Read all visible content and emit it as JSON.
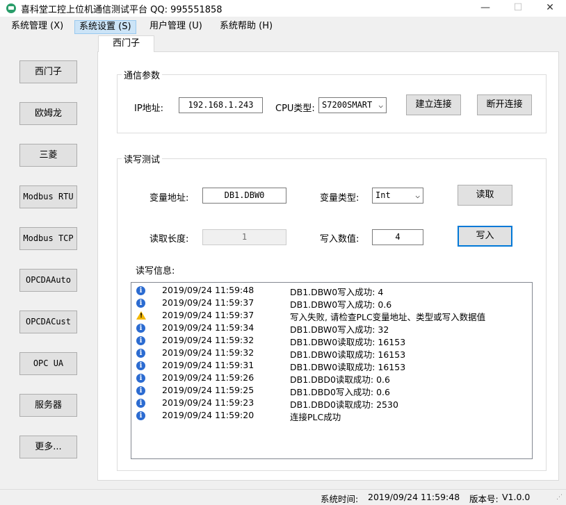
{
  "window": {
    "title": "喜科堂工控上位机通信测试平台 QQ: 995551858",
    "minimize": "—",
    "maximize": "☐",
    "close": "✕"
  },
  "menu": [
    "系统管理 (X)",
    "系统设置 (S)",
    "用户管理 (U)",
    "系统帮助 (H)"
  ],
  "sidebar": [
    "西门子",
    "欧姆龙",
    "三菱",
    "Modbus RTU",
    "Modbus TCP",
    "OPCDAAuto",
    "OPCDACust",
    "OPC UA",
    "服务器",
    "更多..."
  ],
  "tab": {
    "label": "西门子"
  },
  "comm": {
    "title": "通信参数",
    "ip_label": "IP地址:",
    "ip_value": "192.168.1.243",
    "cpu_label": "CPU类型:",
    "cpu_value": "S7200SMART",
    "connect_btn": "建立连接",
    "disconnect_btn": "断开连接"
  },
  "rw": {
    "title": "读写测试",
    "addr_label": "变量地址:",
    "addr_value": "DB1.DBW0",
    "type_label": "变量类型:",
    "type_value": "Int",
    "read_btn": "读取",
    "len_label": "读取长度:",
    "len_value": "1",
    "write_label": "写入数值:",
    "write_value": "4",
    "write_btn": "写入",
    "info_label": "读写信息:"
  },
  "log": [
    {
      "level": "info",
      "time": "2019/09/24 11:59:48",
      "msg": "DB1.DBW0写入成功: 4"
    },
    {
      "level": "info",
      "time": "2019/09/24 11:59:37",
      "msg": "DB1.DBW0写入成功: 0.6"
    },
    {
      "level": "warning",
      "time": "2019/09/24 11:59:37",
      "msg": "写入失败, 请检查PLC变量地址、类型或写入数据值"
    },
    {
      "level": "info",
      "time": "2019/09/24 11:59:34",
      "msg": "DB1.DBW0写入成功: 32"
    },
    {
      "level": "info",
      "time": "2019/09/24 11:59:32",
      "msg": "DB1.DBW0读取成功: 16153"
    },
    {
      "level": "info",
      "time": "2019/09/24 11:59:32",
      "msg": "DB1.DBW0读取成功: 16153"
    },
    {
      "level": "info",
      "time": "2019/09/24 11:59:31",
      "msg": "DB1.DBW0读取成功: 16153"
    },
    {
      "level": "info",
      "time": "2019/09/24 11:59:26",
      "msg": "DB1.DBD0读取成功: 0.6"
    },
    {
      "level": "info",
      "time": "2019/09/24 11:59:25",
      "msg": "DB1.DBD0写入成功: 0.6"
    },
    {
      "level": "info",
      "time": "2019/09/24 11:59:23",
      "msg": "DB1.DBD0读取成功: 2530"
    },
    {
      "level": "info",
      "time": "2019/09/24 11:59:20",
      "msg": "连接PLC成功"
    }
  ],
  "status": {
    "time_label": "系统时间:",
    "time_value": "2019/09/24 11:59:48",
    "version_label": "版本号:",
    "version_value": "V1.0.0"
  }
}
